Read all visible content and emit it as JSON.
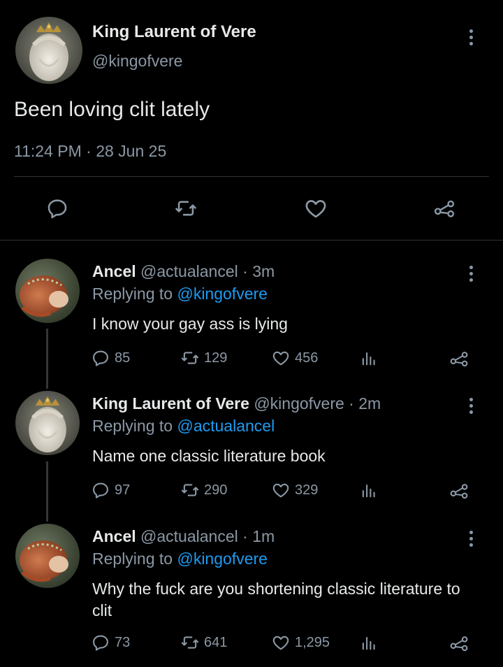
{
  "main_tweet": {
    "name": "King Laurent of Vere",
    "handle": "@kingofvere",
    "text": "Been loving clit lately",
    "time": "11:24 PM",
    "date": "28 Jun 25",
    "meta_separator": " · "
  },
  "replies": [
    {
      "name": "Ancel",
      "handle": "@actualancel",
      "age": "3m",
      "replying_prefix": "Replying to ",
      "replying_to": "@kingofvere",
      "text": "I know your gay ass is lying",
      "replies": "85",
      "retweets": "129",
      "likes": "456"
    },
    {
      "name": "King Laurent of Vere",
      "handle": "@kingofvere",
      "age": "2m",
      "replying_prefix": "Replying to ",
      "replying_to": "@actualancel",
      "text": "Name one classic literature book",
      "replies": "97",
      "retweets": "290",
      "likes": "329"
    },
    {
      "name": "Ancel",
      "handle": "@actualancel",
      "age": "1m",
      "replying_prefix": "Replying to ",
      "replying_to": "@kingofvere",
      "text": "Why the fuck are you shortening classic literature to clit",
      "replies": "73",
      "retweets": "641",
      "likes": "1,295"
    }
  ],
  "colors": {
    "background": "#000000",
    "text": "#e7e9ea",
    "muted": "#8b98a5",
    "link": "#1d9bf0",
    "divider": "#2f3336"
  },
  "icons": [
    "reply-icon",
    "retweet-icon",
    "like-icon",
    "share-icon",
    "analytics-icon",
    "more-icon"
  ]
}
